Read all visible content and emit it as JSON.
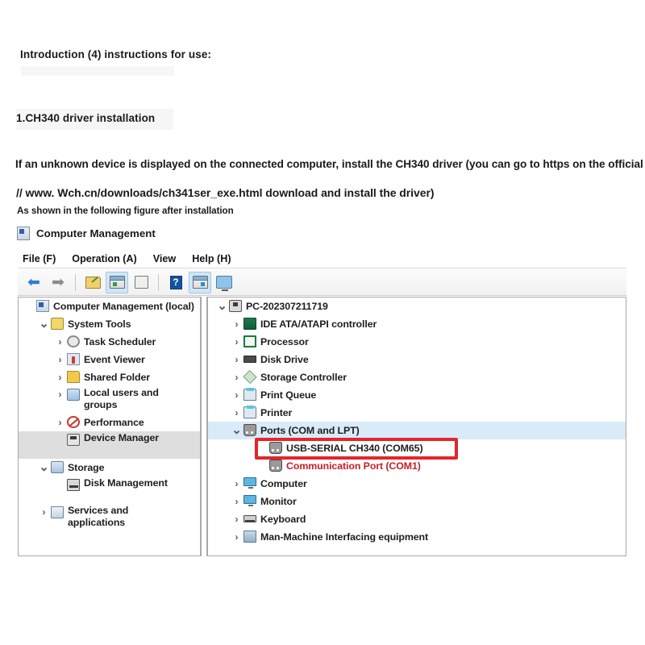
{
  "document": {
    "intro": "Introduction (4) instructions for use:",
    "step_title": "1.CH340 driver installation",
    "body_line1": "If an unknown device is displayed on the connected computer, install the CH340 driver (you can go to https on the official website:",
    "body_line2": "// www. Wch.cn/downloads/ch341ser_exe.html download and install the driver)",
    "body_line3": "As shown in the following figure after installation"
  },
  "window": {
    "title": "Computer Management",
    "title_icon": "computer-management-icon",
    "menu": [
      {
        "label": "File (F)"
      },
      {
        "label": "Operation (A)"
      },
      {
        "label": "View"
      },
      {
        "label": "Help (H)"
      }
    ],
    "toolbar": [
      {
        "name": "back-arrow-icon",
        "glyph": "←",
        "active": false
      },
      {
        "name": "forward-arrow-icon",
        "glyph": "→",
        "active": false
      },
      {
        "name": "separator",
        "glyph": "",
        "active": false
      },
      {
        "name": "folder-edit-icon",
        "glyph": "",
        "active": false
      },
      {
        "name": "show-console-tree-icon",
        "glyph": "",
        "active": true
      },
      {
        "name": "properties-icon",
        "glyph": "",
        "active": false
      },
      {
        "name": "separator",
        "glyph": "",
        "active": false
      },
      {
        "name": "help-icon",
        "glyph": "?",
        "active": false
      },
      {
        "name": "show-action-pane-icon",
        "glyph": "",
        "active": true
      },
      {
        "name": "display-icon",
        "glyph": "",
        "active": false
      }
    ]
  },
  "left_tree": [
    {
      "label": "Computer Management (local)",
      "icon": "computer-management-icon",
      "twisty": "",
      "indent": 1,
      "selected": "none",
      "wrap": false
    },
    {
      "label": "System Tools",
      "icon": "system-tools-icon",
      "twisty": "v",
      "indent": 2,
      "selected": "none",
      "wrap": false
    },
    {
      "label": "Task Scheduler",
      "icon": "clock-icon",
      "twisty": ">",
      "indent": 3,
      "selected": "none",
      "wrap": false
    },
    {
      "label": "Event Viewer",
      "icon": "event-viewer-icon",
      "twisty": ">",
      "indent": 3,
      "selected": "none",
      "wrap": false
    },
    {
      "label": "Shared Folder",
      "icon": "folder-icon",
      "twisty": ">",
      "indent": 3,
      "selected": "none",
      "wrap": false
    },
    {
      "label": "Local users and groups",
      "icon": "users-icon",
      "twisty": ">",
      "indent": 3,
      "selected": "none",
      "wrap": true
    },
    {
      "label": "Performance",
      "icon": "performance-icon",
      "twisty": ">",
      "indent": 3,
      "selected": "none",
      "wrap": false
    },
    {
      "label": "Device Manager",
      "icon": "device-manager-icon",
      "twisty": "",
      "indent": 3,
      "selected": "gray",
      "wrap": true
    },
    {
      "label": "Storage",
      "icon": "storage-icon",
      "twisty": "v",
      "indent": 2,
      "selected": "none",
      "wrap": false
    },
    {
      "label": "Disk Management",
      "icon": "disk-icon",
      "twisty": "",
      "indent": 3,
      "selected": "none",
      "wrap": true
    },
    {
      "label": "Services and applications",
      "icon": "services-icon",
      "twisty": ">",
      "indent": 2,
      "selected": "none",
      "wrap": true
    }
  ],
  "device_tree": [
    {
      "label": "PC-202307211719",
      "icon": "pc-icon",
      "twisty": "v",
      "indent": 1,
      "highlight": "none",
      "color": "normal"
    },
    {
      "label": "IDE ATA/ATAPI controller",
      "icon": "ide-controller-icon",
      "twisty": ">",
      "indent": 2,
      "highlight": "none",
      "color": "normal"
    },
    {
      "label": "Processor",
      "icon": "processor-icon",
      "twisty": ">",
      "indent": 2,
      "highlight": "none",
      "color": "normal"
    },
    {
      "label": "Disk Drive",
      "icon": "disk-drive-icon",
      "twisty": ">",
      "indent": 2,
      "highlight": "none",
      "color": "normal"
    },
    {
      "label": "Storage Controller",
      "icon": "storage-controller-icon",
      "twisty": ">",
      "indent": 2,
      "highlight": "none",
      "color": "normal"
    },
    {
      "label": "Print Queue",
      "icon": "printer-icon",
      "twisty": ">",
      "indent": 2,
      "highlight": "none",
      "color": "normal"
    },
    {
      "label": "Printer",
      "icon": "printer-icon",
      "twisty": ">",
      "indent": 2,
      "highlight": "none",
      "color": "normal"
    },
    {
      "label": "Ports (COM and LPT)",
      "icon": "port-icon",
      "twisty": "v",
      "indent": 2,
      "highlight": "blue",
      "color": "normal"
    },
    {
      "label": "USB-SERIAL CH340 (COM65)",
      "icon": "port-icon",
      "twisty": "",
      "indent": 3,
      "highlight": "none",
      "color": "normal"
    },
    {
      "label": "Communication Port (COM1)",
      "icon": "port-icon",
      "twisty": "",
      "indent": 3,
      "highlight": "none",
      "color": "red"
    },
    {
      "label": "Computer",
      "icon": "monitor-icon",
      "twisty": ">",
      "indent": 2,
      "highlight": "none",
      "color": "normal"
    },
    {
      "label": "Monitor",
      "icon": "monitor-icon",
      "twisty": ">",
      "indent": 2,
      "highlight": "none",
      "color": "normal"
    },
    {
      "label": "Keyboard",
      "icon": "keyboard-icon",
      "twisty": ">",
      "indent": 2,
      "highlight": "none",
      "color": "normal"
    },
    {
      "label": "Man-Machine Interfacing equipment",
      "icon": "hid-icon",
      "twisty": ">",
      "indent": 2,
      "highlight": "none",
      "color": "normal"
    }
  ],
  "annotation": {
    "target_label": "USB-SERIAL CH340 (COM65)",
    "box_color": "#e3262b"
  },
  "colors": {
    "selection_blue": "#d9eaf8",
    "selection_gray": "#dedede",
    "red_text": "#c32028",
    "annotation_red": "#e3262b",
    "text": "#1e1e1e"
  }
}
